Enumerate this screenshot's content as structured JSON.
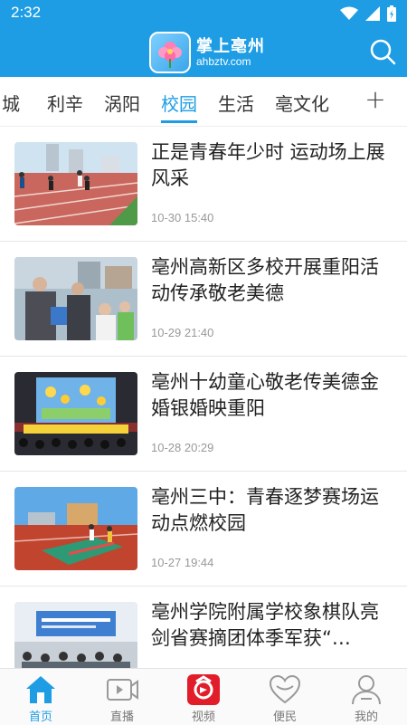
{
  "status_bar": {
    "time": "2:32"
  },
  "header": {
    "logo_title": "掌上亳州",
    "logo_domain": "ahbztv.com",
    "search_icon": "search-icon"
  },
  "tabs": [
    {
      "label": "城"
    },
    {
      "label": "利辛"
    },
    {
      "label": "涡阳"
    },
    {
      "label": "校园",
      "active": true
    },
    {
      "label": "生活"
    },
    {
      "label": "亳文化"
    }
  ],
  "tab_more_icon": "plus-icon",
  "feed": [
    {
      "title": "正是青春年少时 运动场上展风采",
      "time": "10-30 15:40"
    },
    {
      "title": "亳州高新区多校开展重阳活动传承敬老美德",
      "time": "10-29 21:40"
    },
    {
      "title": "亳州十幼童心敬老传美德金婚银婚映重阳",
      "time": "10-28 20:29"
    },
    {
      "title": "亳州三中：青春逐梦赛场运动点燃校园",
      "time": "10-27 19:44"
    },
    {
      "title": "亳州学院附属学校象棋队亮剑省赛摘团体季军获“…",
      "time": ""
    }
  ],
  "bottom_nav": [
    {
      "label": "首页",
      "icon": "home-icon",
      "active": true
    },
    {
      "label": "直播",
      "icon": "video-icon"
    },
    {
      "label": "视频",
      "icon": "video-logo-icon"
    },
    {
      "label": "便民",
      "icon": "heart-icon"
    },
    {
      "label": "我的",
      "icon": "user-icon"
    }
  ],
  "colors": {
    "accent": "#1e9de4"
  }
}
